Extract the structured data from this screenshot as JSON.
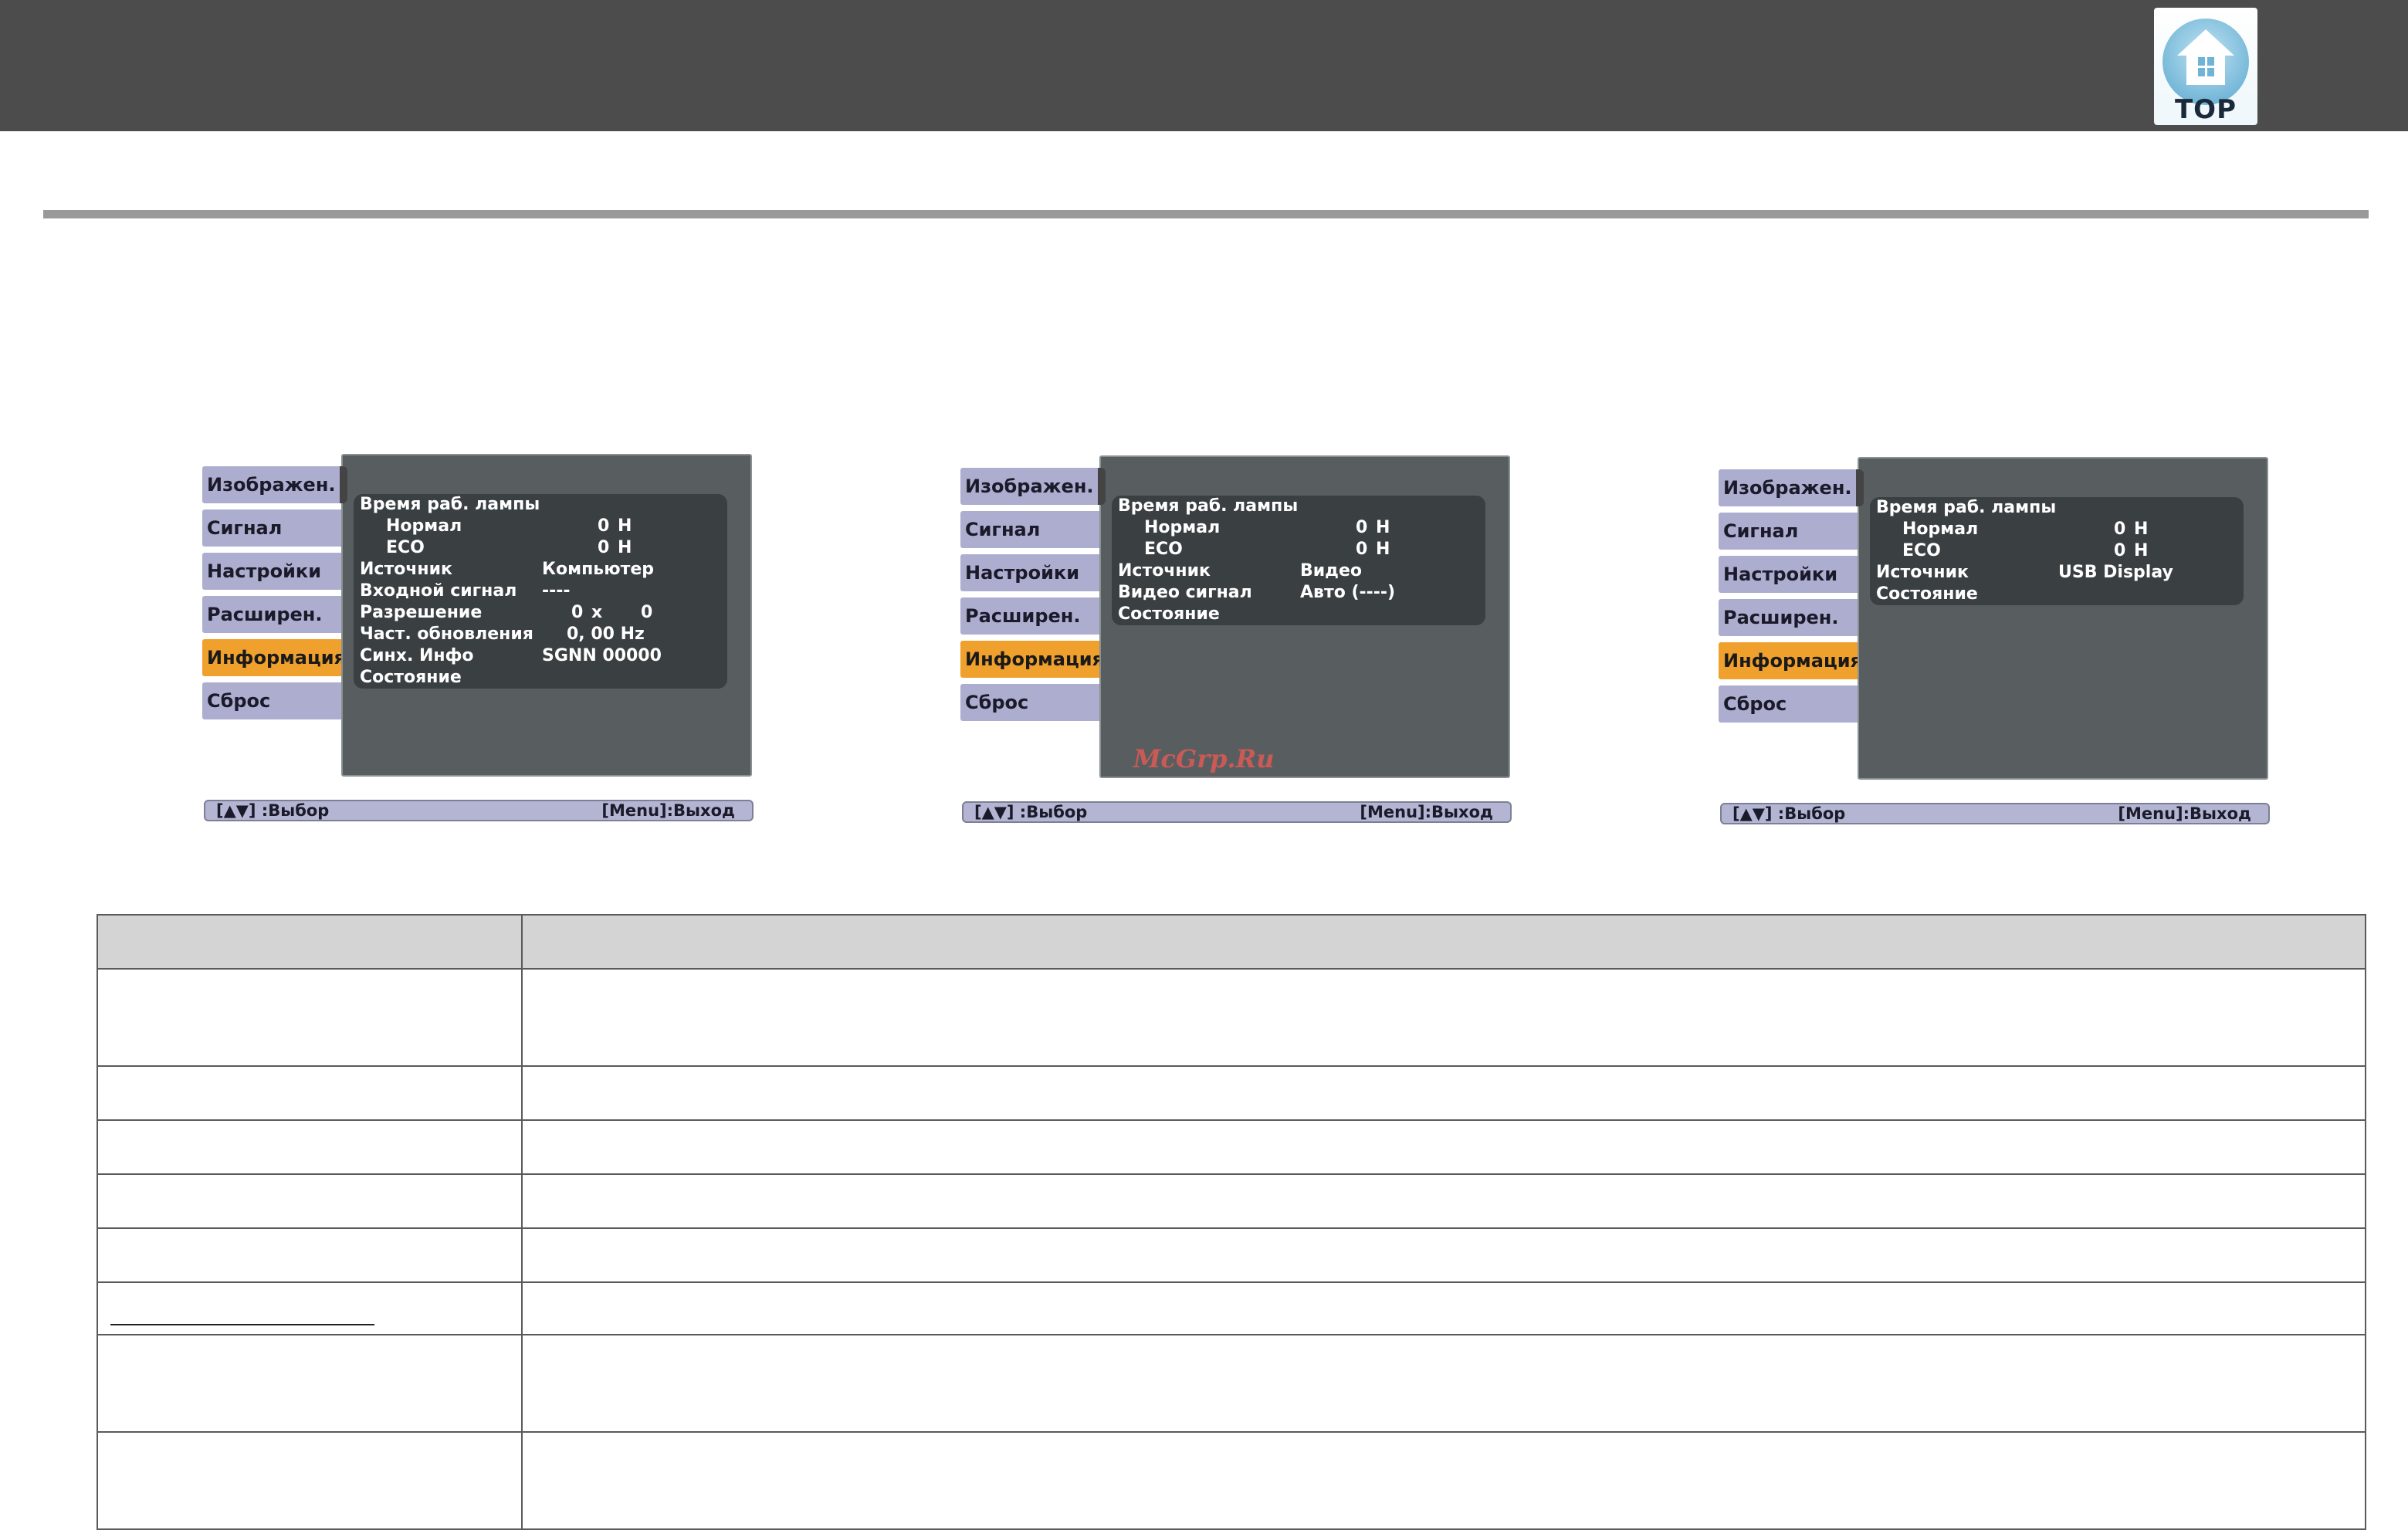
{
  "header": {
    "top_button_label": "TOP"
  },
  "osd_panels": [
    {
      "sidebar": [
        "Изображен.",
        "Сигнал",
        "Настройки",
        "Расширен.",
        "Информация",
        "Сброс"
      ],
      "active_index": 4,
      "rows": {
        "lamp_hours": "Время раб. лампы",
        "normal_label": "Нормал",
        "normal_value": "0",
        "normal_unit": "H",
        "eco_label": "ECO",
        "eco_value": "0",
        "eco_unit": "H",
        "source_label": "Источник",
        "source_value": "Компьютер",
        "input_signal_label": "Входной сигнал",
        "input_signal_value": "----",
        "resolution_label": "Разрешение",
        "resolution_w": "0",
        "resolution_x": "x",
        "resolution_h": "0",
        "refresh_label": "Част. обновления",
        "refresh_value": "0, 00 Hz",
        "sync_label": "Синх. Инфо",
        "sync_value": "SGNN 00000",
        "status_label": "Состояние"
      },
      "footer": {
        "select": "[▲▼] :Выбор",
        "exit": "[Menu]:Выход"
      }
    },
    {
      "sidebar": [
        "Изображен.",
        "Сигнал",
        "Настройки",
        "Расширен.",
        "Информация",
        "Сброс"
      ],
      "active_index": 4,
      "rows": {
        "lamp_hours": "Время раб. лампы",
        "normal_label": "Нормал",
        "normal_value": "0",
        "normal_unit": "H",
        "eco_label": "ECO",
        "eco_value": "0",
        "eco_unit": "H",
        "source_label": "Источник",
        "source_value": "Видео",
        "video_signal_label": "Видео сигнал",
        "video_signal_value": "Авто (----)",
        "status_label": "Состояние"
      },
      "footer": {
        "select": "[▲▼] :Выбор",
        "exit": "[Menu]:Выход"
      }
    },
    {
      "sidebar": [
        "Изображен.",
        "Сигнал",
        "Настройки",
        "Расширен.",
        "Информация",
        "Сброс"
      ],
      "active_index": 4,
      "rows": {
        "lamp_hours": "Время раб. лампы",
        "normal_label": "Нормал",
        "normal_value": "0",
        "normal_unit": "H",
        "eco_label": "ECO",
        "eco_value": "0",
        "eco_unit": "H",
        "source_label": "Источник",
        "source_value": "USB Display",
        "status_label": "Состояние"
      },
      "footer": {
        "select": "[▲▼] :Выбор",
        "exit": "[Menu]:Выход"
      }
    }
  ],
  "watermark": "McGrp.Ru",
  "colors": {
    "topbar": "#4c4c4c",
    "sidebar_item": "#adaecf",
    "sidebar_active": "#f0a02c",
    "panel_bg": "#585e60",
    "rows_bg": "#3a3f41",
    "table_header_bg": "#d4d4d4"
  }
}
